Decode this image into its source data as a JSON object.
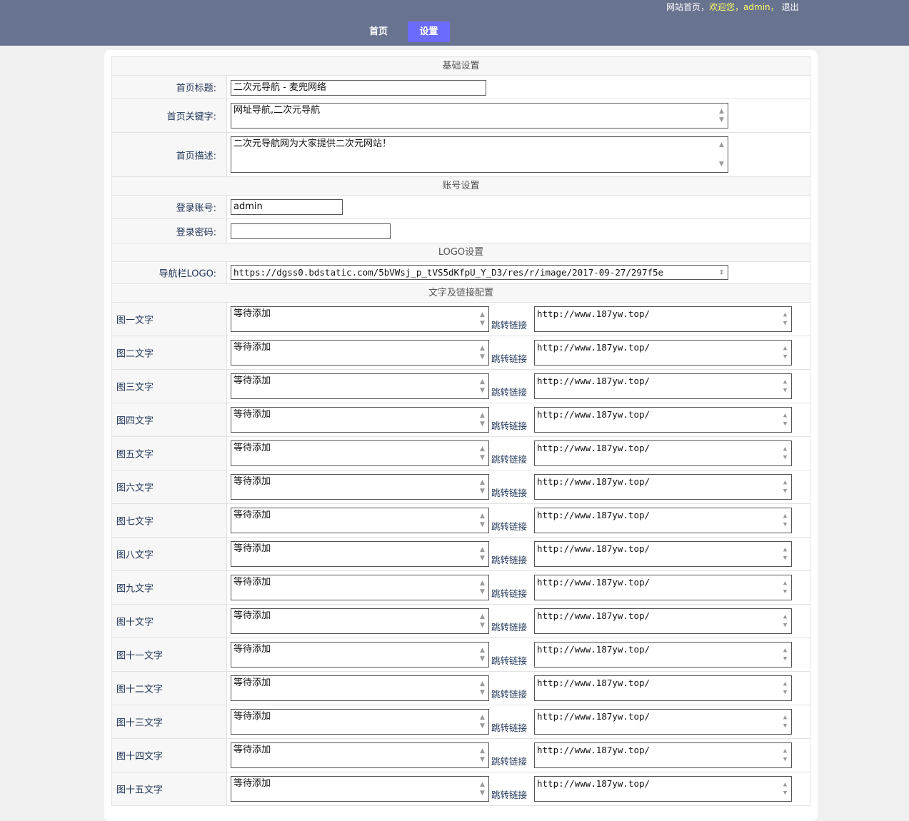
{
  "header": {
    "links": {
      "site_home": "网站首页",
      "sep1": "，",
      "welcome": "欢迎您，admin，",
      "logout": "退出"
    },
    "nav": {
      "home": "首页",
      "settings": "设置"
    }
  },
  "sections": {
    "basic": "基础设置",
    "account": "账号设置",
    "logo": "LOGO设置",
    "links": "文字及链接配置"
  },
  "basic": {
    "title_label": "首页标题:",
    "title_value": "二次元导航 - 麦兜网络",
    "keywords_label": "首页关键字:",
    "keywords_value": "网址导航,二次元导航",
    "desc_label": "首页描述:",
    "desc_value": "二次元导航网为大家提供二次元网站！"
  },
  "account": {
    "username_label": "登录账号:",
    "username_value": "admin",
    "password_label": "登录密码:",
    "password_value": ""
  },
  "logo": {
    "label": "导航栏LOGO:",
    "value": "https://dgss0.bdstatic.com/5bVWsj_p_tVS5dKfpU_Y_D3/res/r/image/2017-09-27/297f5e"
  },
  "jump_label": "跳转链接",
  "items": [
    {
      "label": "图一文字",
      "text": "等待添加",
      "link": "http://www.187yw.top/"
    },
    {
      "label": "图二文字",
      "text": "等待添加",
      "link": "http://www.187yw.top/"
    },
    {
      "label": "图三文字",
      "text": "等待添加",
      "link": "http://www.187yw.top/"
    },
    {
      "label": "图四文字",
      "text": "等待添加",
      "link": "http://www.187yw.top/"
    },
    {
      "label": "图五文字",
      "text": "等待添加",
      "link": "http://www.187yw.top/"
    },
    {
      "label": "图六文字",
      "text": "等待添加",
      "link": "http://www.187yw.top/"
    },
    {
      "label": "图七文字",
      "text": "等待添加",
      "link": "http://www.187yw.top/"
    },
    {
      "label": "图八文字",
      "text": "等待添加",
      "link": "http://www.187yw.top/"
    },
    {
      "label": "图九文字",
      "text": "等待添加",
      "link": "http://www.187yw.top/"
    },
    {
      "label": "图十文字",
      "text": "等待添加",
      "link": "http://www.187yw.top/"
    },
    {
      "label": "图十一文字",
      "text": "等待添加",
      "link": "http://www.187yw.top/"
    },
    {
      "label": "图十二文字",
      "text": "等待添加",
      "link": "http://www.187yw.top/"
    },
    {
      "label": "图十三文字",
      "text": "等待添加",
      "link": "http://www.187yw.top/"
    },
    {
      "label": "图十四文字",
      "text": "等待添加",
      "link": "http://www.187yw.top/"
    },
    {
      "label": "图十五文字",
      "text": "等待添加",
      "link": "http://www.187yw.top/"
    }
  ]
}
